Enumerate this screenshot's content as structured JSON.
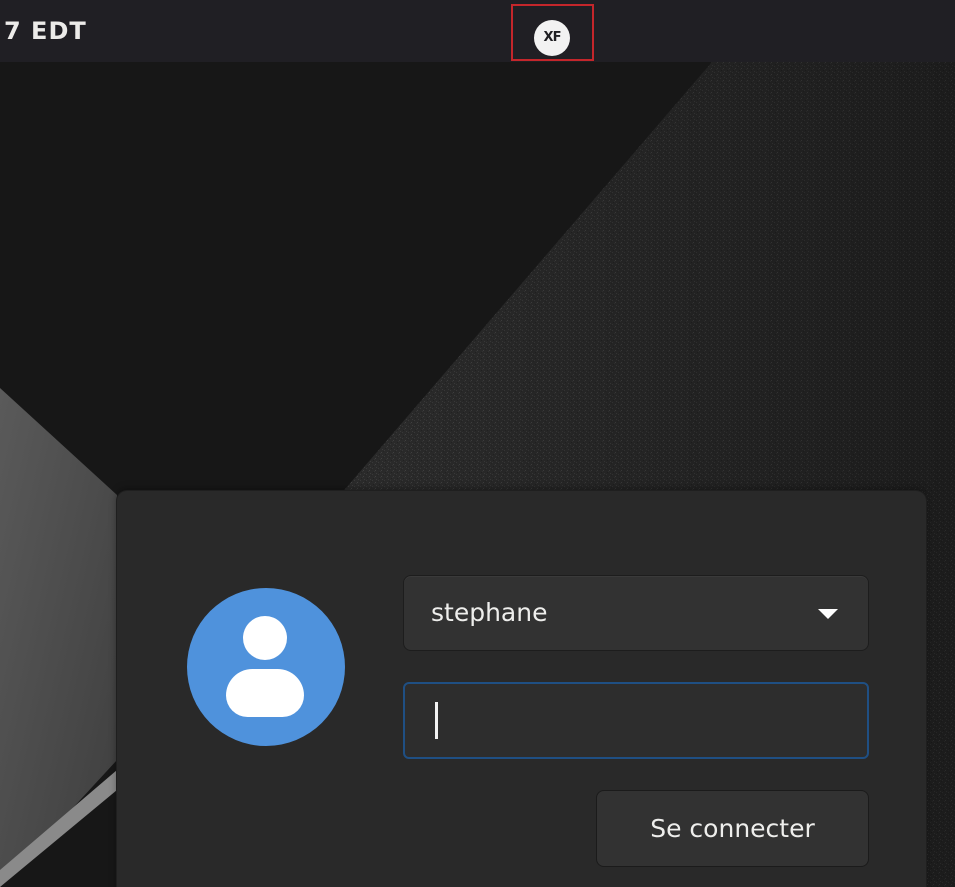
{
  "topbar": {
    "clock_text": "7 EDT",
    "logo_text": "XF",
    "logo_icon": "xf-logo-icon"
  },
  "login": {
    "avatar_icon": "user-avatar-icon",
    "username": "stephane",
    "dropdown_icon": "triangle-down-icon",
    "password_value": "",
    "connect_label": "Se connecter"
  },
  "colors": {
    "topbar_bg": "#201f24",
    "panel_bg": "#292929",
    "avatar_bg": "#4f92dc",
    "focus_border": "#1f4f83",
    "highlight_border": "#c4262b"
  }
}
